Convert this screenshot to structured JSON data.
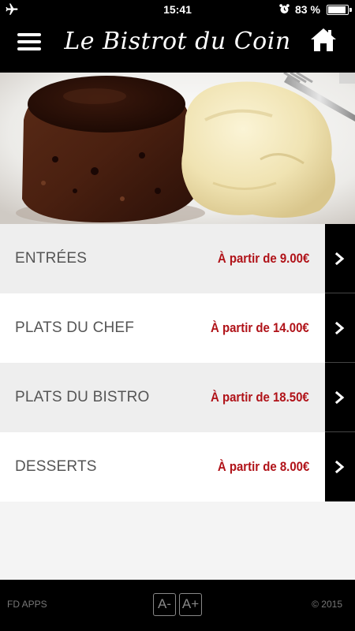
{
  "status_bar": {
    "time": "15:41",
    "battery_percent_text": "83 %",
    "battery_level": 0.83,
    "icons": [
      "airplane-icon",
      "alarm-icon",
      "battery-icon"
    ]
  },
  "header": {
    "title": "Le Bistrot du Coin",
    "menu_icon": "hamburger-menu-icon",
    "home_icon": "home-icon"
  },
  "hero": {
    "description_icon": "dessert-photo"
  },
  "menu": {
    "items": [
      {
        "label": "ENTRÉES",
        "price": "À partir de 9.00€"
      },
      {
        "label": "PLATS DU CHEF",
        "price": "À partir de 14.00€"
      },
      {
        "label": "PLATS DU BISTRO",
        "price": "À partir de 18.50€"
      },
      {
        "label": "DESSERTS",
        "price": "À partir de 8.00€"
      }
    ],
    "arrow_icon": "chevron-right-icon"
  },
  "footer": {
    "brand": "FD APPS",
    "font_decrease": "A-",
    "font_increase": "A+",
    "copyright": "© 2015"
  },
  "colors": {
    "bar_background": "#000000",
    "price_red": "#b01218",
    "row_grey": "#eeeeee",
    "row_white": "#ffffff"
  }
}
